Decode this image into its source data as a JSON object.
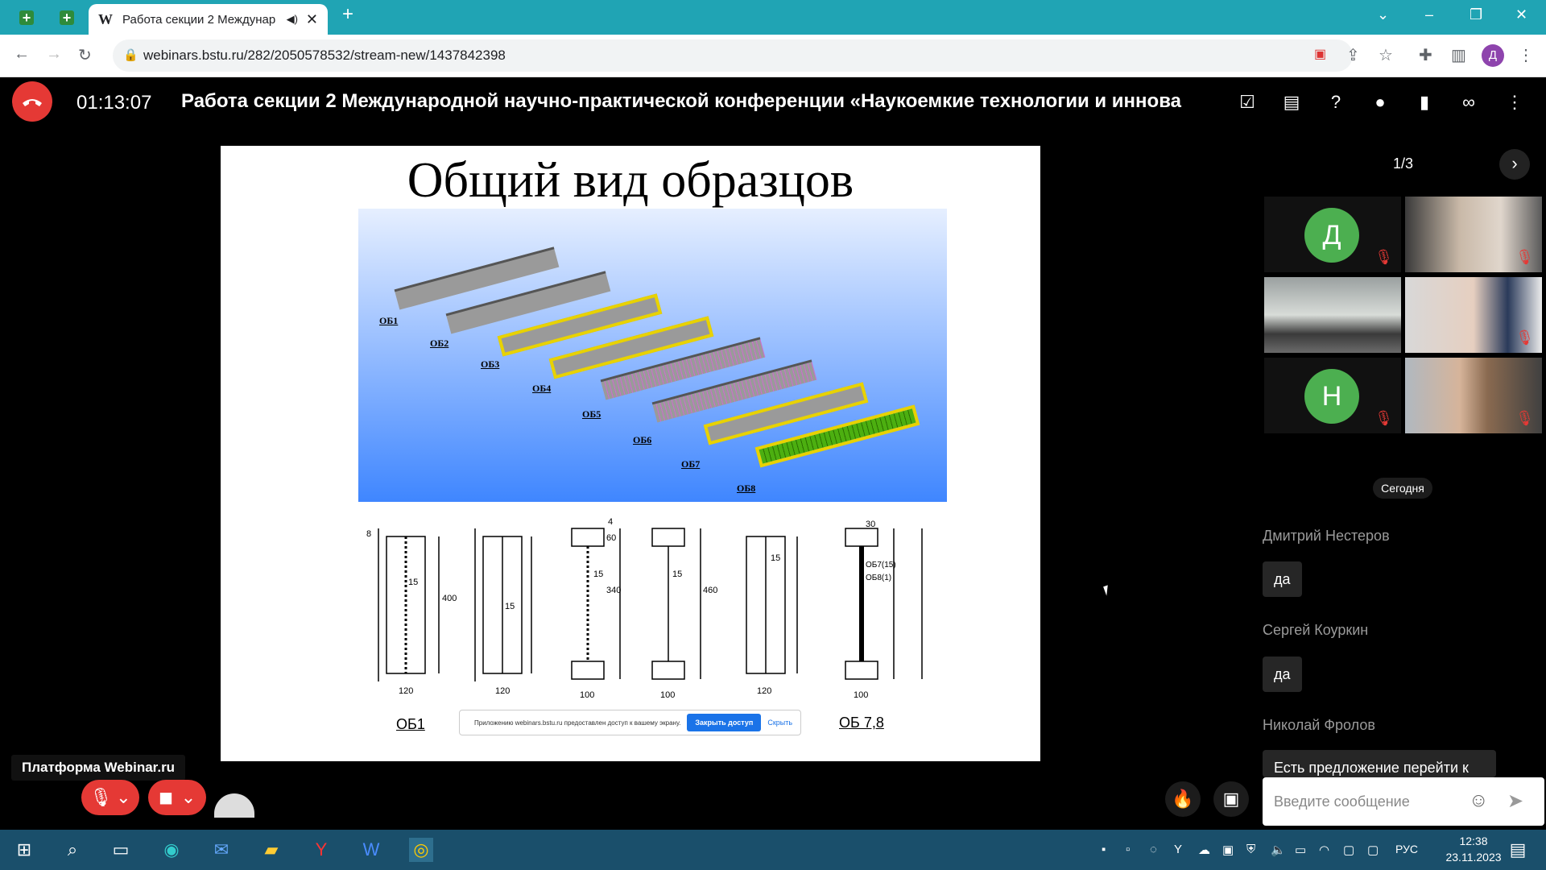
{
  "browser": {
    "tab_title": "Работа секции 2 Междунар",
    "tab_favicon": "W",
    "url": "webinars.bstu.ru/282/2050578532/stream-new/1437842398",
    "profile_initial": "Д"
  },
  "webinar": {
    "timer": "01:13:07",
    "title": "Работа секции 2 Международной научно-практической конференции «Наукоемкие технологии и иннова",
    "brand": "Платформа Webinar.ru"
  },
  "slide": {
    "title": "Общий вид образцов",
    "beam_labels": [
      "ОБ1",
      "ОБ2",
      "ОБ3",
      "ОБ4",
      "ОБ5",
      "ОБ6",
      "ОБ7",
      "ОБ8"
    ],
    "drawing_labels": [
      "ОБ1",
      "ОБ 7,8"
    ],
    "drawing_dims": [
      "120",
      "120",
      "100",
      "100",
      "120",
      "100",
      "400",
      "15",
      "60",
      "340",
      "460",
      "8",
      "30",
      "4",
      "ОБ7(15)",
      "ОБ8(1)"
    ],
    "share_notice": "Приложению webinars.bstu.ru предоставлен доступ к вашему экрану.",
    "share_stop": "Закрыть доступ",
    "share_hide": "Скрыть"
  },
  "participants": {
    "pager": "1/3",
    "tiles": [
      {
        "type": "avatar",
        "initial": "Д"
      },
      {
        "type": "video"
      },
      {
        "type": "video"
      },
      {
        "type": "video"
      },
      {
        "type": "avatar",
        "initial": "Н"
      },
      {
        "type": "video"
      }
    ]
  },
  "chat": {
    "date": "Сегодня",
    "messages": [
      {
        "author": "Дмитрий Нестеров",
        "text": "да"
      },
      {
        "author": "Сергей Коуркин",
        "text": "да"
      },
      {
        "author": "Николай Фролов",
        "text": "Есть предложение перейти к"
      }
    ],
    "placeholder": "Введите сообщение"
  },
  "taskbar": {
    "lang": "РУС",
    "time": "12:38",
    "date": "23.11.2023"
  },
  "colors": {
    "accent": "#20a4b4",
    "danger": "#e53935",
    "avatar": "#4caf50"
  }
}
